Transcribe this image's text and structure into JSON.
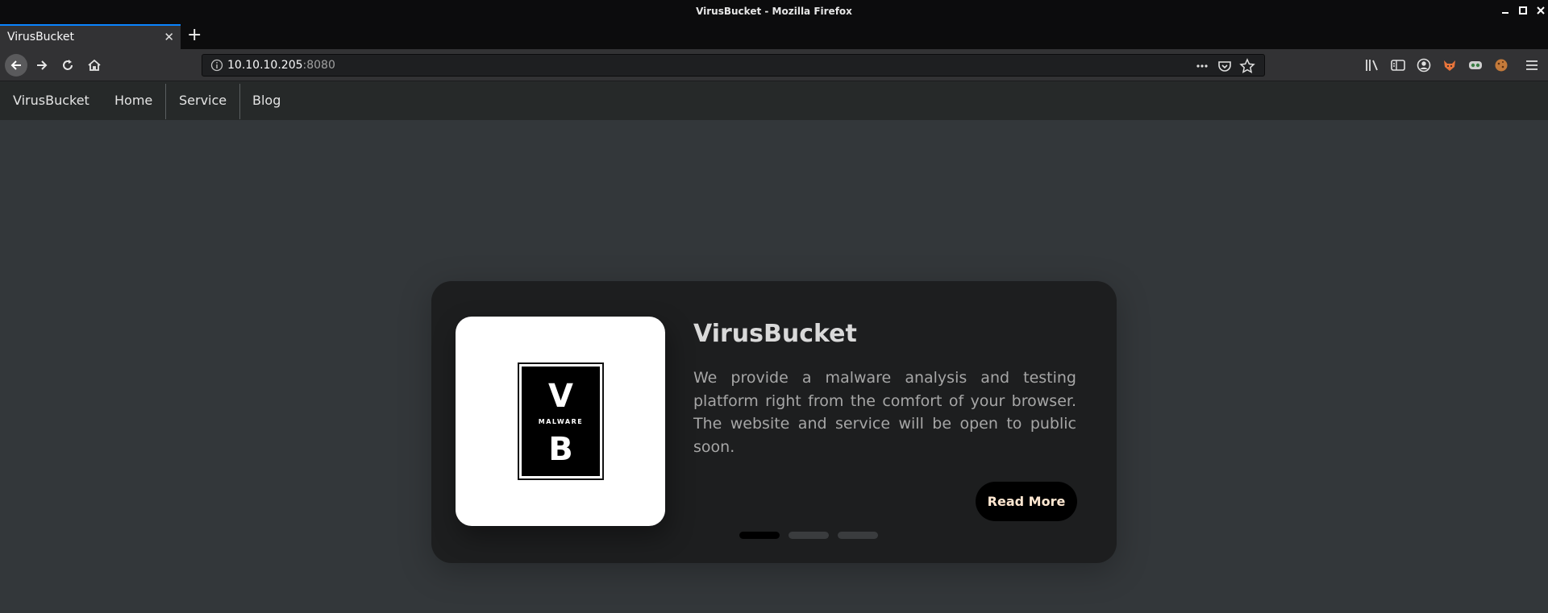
{
  "window": {
    "title": "VirusBucket - Mozilla Firefox"
  },
  "tab": {
    "title": "VirusBucket"
  },
  "url": {
    "host": "10.10.10.205",
    "port": ":8080"
  },
  "toolbar_icons": [
    "library-icon",
    "sidebar-icon",
    "account-icon",
    "extension-fox-icon",
    "extension-mask-icon",
    "extension-cookie-icon",
    "menu-icon"
  ],
  "site_nav": {
    "brand": "VirusBucket",
    "items": [
      "Home",
      "Service",
      "Blog"
    ]
  },
  "card": {
    "title": "VirusBucket",
    "text": "We provide a malware analysis and testing platform right from the comfort of your browser. The website and service will be open to public soon.",
    "button": "Read More",
    "logo": {
      "top": "V",
      "middle": "MALWARE",
      "bottom": "B"
    },
    "slides": 3,
    "active_slide": 1
  },
  "colors": {
    "accent": "#0a84ff",
    "card": "#1d1e1f",
    "button_text": "#ffe7d1"
  }
}
